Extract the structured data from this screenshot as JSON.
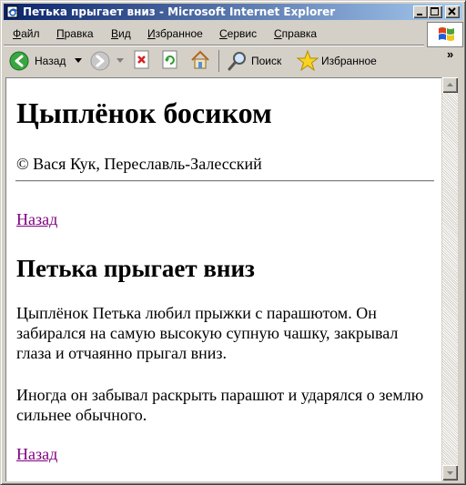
{
  "window": {
    "title": "Петька прыгает вниз - Microsoft Internet Explorer"
  },
  "menubar": {
    "items": [
      {
        "underlined": "Ф",
        "rest": "айл"
      },
      {
        "underlined": "П",
        "rest": "равка"
      },
      {
        "underlined": "В",
        "rest": "ид"
      },
      {
        "underlined": "И",
        "rest": "збранное"
      },
      {
        "underlined": "С",
        "rest": "ервис"
      },
      {
        "underlined": "С",
        "rest": "правка"
      }
    ]
  },
  "toolbar": {
    "back_label": "Назад",
    "search_label": "Поиск",
    "favorites_label": "Избранное",
    "chevron": "»"
  },
  "page": {
    "site_title": "Цыплёнок босиком",
    "copyright": "© Вася Кук, Переславль-Залесский",
    "back_link_top": "Назад",
    "heading": "Петька прыгает вниз",
    "paragraph1": "Цыплёнок Петька любил прыжки с парашютом. Он забирался на самую высокую супную чашку, закрывал глаза и отчаянно прыгал вниз.",
    "paragraph2": "Иногда он забывал раскрыть парашют и ударялся о землю сильнее обычного.",
    "back_link_bottom": "Назад"
  },
  "colors": {
    "title_gradient_start": "#0a246a",
    "title_gradient_end": "#a6caf0",
    "visited_link": "#800080"
  }
}
